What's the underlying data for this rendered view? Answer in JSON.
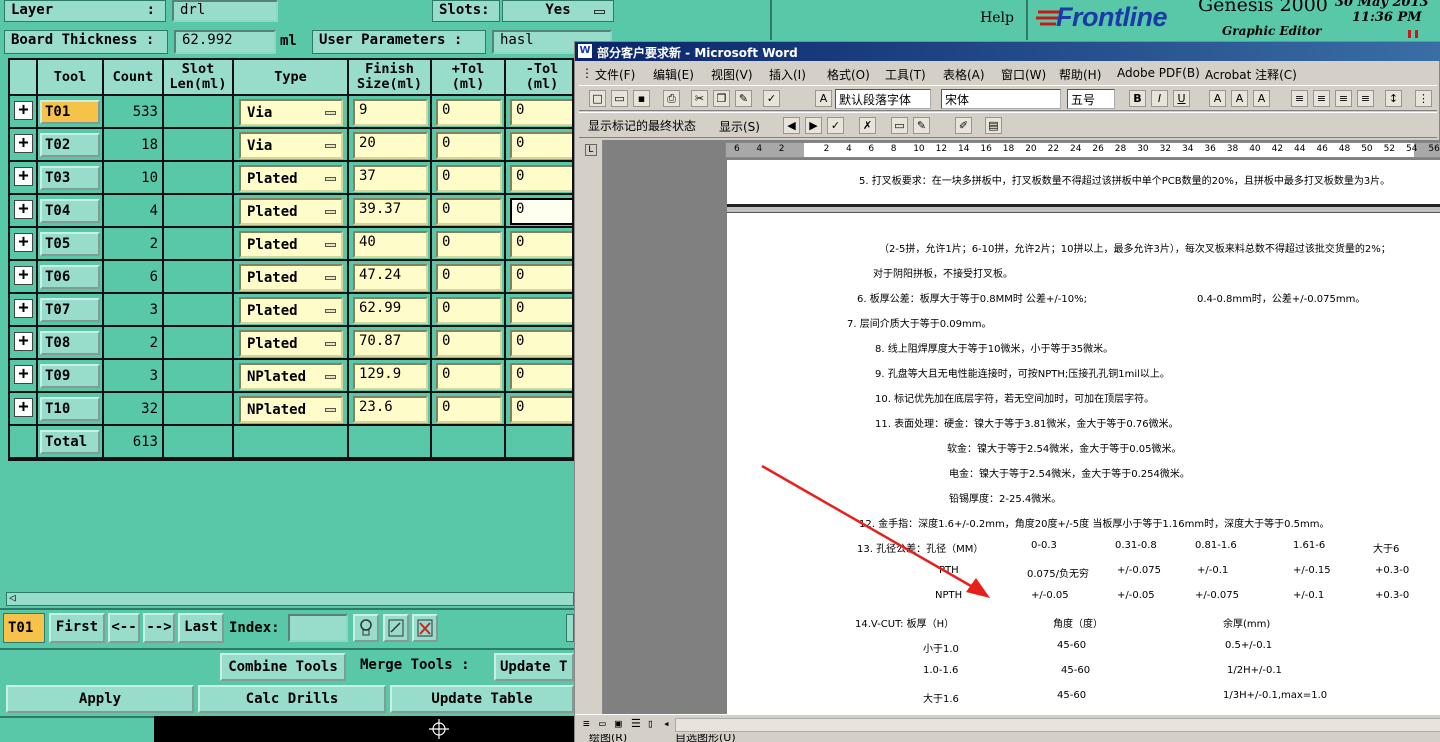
{
  "genesis": {
    "layer_label": "Layer",
    "layer_colon": ":",
    "layer_value": "drl",
    "slots_label": "Slots:",
    "slots_value": "Yes",
    "board_thickness_label": "Board Thickness :",
    "board_thickness_value": "62.992",
    "board_thickness_unit": "ml",
    "user_params_label": "User Parameters :",
    "user_params_value": "hasl",
    "columns": [
      "Tool",
      "Count",
      "Slot Len(ml)",
      "Type",
      "Finish Size(ml)",
      "+Tol (ml)",
      "-Tol (ml)"
    ],
    "column_lines": {
      "slot": [
        "Slot",
        "Len(ml)"
      ],
      "finish": [
        "Finish",
        "Size(ml)"
      ],
      "ptol": [
        "+Tol",
        "(ml)"
      ],
      "mtol": [
        "-Tol",
        "(ml)"
      ]
    },
    "rows": [
      {
        "tool": "T01",
        "count": "533",
        "type": "Via",
        "finish": "9",
        "ptol": "0",
        "mtol": "0"
      },
      {
        "tool": "T02",
        "count": "18",
        "type": "Via",
        "finish": "20",
        "ptol": "0",
        "mtol": "0"
      },
      {
        "tool": "T03",
        "count": "10",
        "type": "Plated",
        "finish": "37",
        "ptol": "0",
        "mtol": "0"
      },
      {
        "tool": "T04",
        "count": "4",
        "type": "Plated",
        "finish": "39.37",
        "ptol": "0",
        "mtol": "0"
      },
      {
        "tool": "T05",
        "count": "2",
        "type": "Plated",
        "finish": "40",
        "ptol": "0",
        "mtol": "0"
      },
      {
        "tool": "T06",
        "count": "6",
        "type": "Plated",
        "finish": "47.24",
        "ptol": "0",
        "mtol": "0"
      },
      {
        "tool": "T07",
        "count": "3",
        "type": "Plated",
        "finish": "62.99",
        "ptol": "0",
        "mtol": "0"
      },
      {
        "tool": "T08",
        "count": "2",
        "type": "Plated",
        "finish": "70.87",
        "ptol": "0",
        "mtol": "0"
      },
      {
        "tool": "T09",
        "count": "3",
        "type": "NPlated",
        "finish": "129.9",
        "ptol": "0",
        "mtol": "0"
      },
      {
        "tool": "T10",
        "count": "32",
        "type": "NPlated",
        "finish": "23.6",
        "ptol": "0",
        "mtol": "0"
      }
    ],
    "total_label": "Total",
    "total_count": "613",
    "nav": {
      "current": "T01",
      "first": "First",
      "prev": "<--",
      "next": "-->",
      "last": "Last",
      "index_label": "Index:"
    },
    "combine_tools": "Combine Tools",
    "merge_tools": "Merge Tools :",
    "update_t": "Update T",
    "apply": "Apply",
    "calc_drills": "Calc Drills",
    "update_table": "Update Table"
  },
  "banner": {
    "help": "Help",
    "logo": "Frontline",
    "product": "Genesis 2000",
    "subtitle": "Graphic Editor",
    "date": "30 May 2013",
    "time": "11:36 PM"
  },
  "word": {
    "title": "部分客户要求新 - Microsoft Word",
    "menu": [
      "文件(F)",
      "编辑(E)",
      "视图(V)",
      "插入(I)",
      "格式(O)",
      "工具(T)",
      "表格(A)",
      "窗口(W)",
      "帮助(H)",
      "Adobe PDF(B)",
      "Acrobat 注释(C)"
    ],
    "style_combo": "默认段落字体",
    "font_combo": "宋体",
    "size_combo": "五号",
    "review_combo": "显示标记的最终状态",
    "show_label": "显示(S)",
    "ruler": [
      "6",
      "4",
      "2",
      "",
      "2",
      "4",
      "6",
      "8",
      "10",
      "12",
      "14",
      "16",
      "18",
      "20",
      "22",
      "24",
      "26",
      "28",
      "30",
      "32",
      "34",
      "36",
      "38",
      "40",
      "42",
      "44",
      "46",
      "48",
      "50",
      "52",
      "54",
      "56"
    ],
    "doc_lines": [
      "5. 打叉板要求：在一块多拼板中，打叉板数量不得超过该拼板中单个PCB数量的20%，且拼板中最多打叉板数量为3片。",
      "（2-5拼，允许1片；6-10拼，允许2片；10拼以上，最多允许3片），每次叉板来料总数不得超过该批交货量的2%；",
      "对于阴阳拼板，不接受打叉板。",
      "6. 板厚公差：板厚大于等于0.8MM时  公差+/-10%;",
      "0.4-0.8mm时，公差+/-0.075mm。",
      "7.   层间介质大于等于0.09mm。",
      "8. 线上阻焊厚度大于等于10微米，小于等于35微米。",
      "9. 孔盘等大且无电性能连接时，可按NPTH;压接孔孔铜1mil以上。",
      "10. 标记优先加在底层字符，若无空间加时，可加在顶层字符。",
      "11. 表面处理：硬金：镍大于等于3.81微米，金大于等于0.76微米。",
      "软金：镍大于等于2.54微米，金大于等于0.05微米。",
      "电金：镍大于等于2.54微米，金大于等于0.254微米。",
      "铅锡厚度：2-25.4微米。",
      "12. 金手指：深度1.6+/-0.2mm，角度20度+/-5度 当板厚小于等于1.16mm时，深度大于等于0.5mm。",
      "13. 孔径公差：孔径（MM）"
    ],
    "hole_table": {
      "header": [
        "0-0.3",
        "0.31-0.8",
        "0.81-1.6",
        "1.61-6",
        "大于6"
      ],
      "pth_label": "PTH",
      "pth": [
        "0.075/负无穷",
        "+/-0.075",
        "+/-0.1",
        "+/-0.15",
        "+0.3-0"
      ],
      "npth_label": "NPTH",
      "npth": [
        "+/-0.05",
        "+/-0.05",
        "+/-0.075",
        "+/-0.1",
        "+0.3-0"
      ]
    },
    "vcut": {
      "title": "14.V-CUT:  板厚（H）",
      "angle_header": "角度（度）",
      "rest_header": "余厚(mm)",
      "rows": [
        {
          "h": "小于1.0",
          "angle": "45-60",
          "rest": "0.5+/-0.1"
        },
        {
          "h": "1.0-1.6",
          "angle": "45-60",
          "rest": "1/2H+/-0.1"
        },
        {
          "h": "大于1.6",
          "angle": "45-60",
          "rest": "1/3H+/-0.1,max=1.0"
        }
      ]
    },
    "drawbar_label": "绘图(R)",
    "autoshape_label": "自选图形(U)"
  },
  "colors": {
    "teal_bg": "#58c8a8",
    "teal_light": "#98dccc",
    "cream": "#fefcc8",
    "selected": "#f6c24a",
    "annotation_arrow": "#e8201c"
  }
}
